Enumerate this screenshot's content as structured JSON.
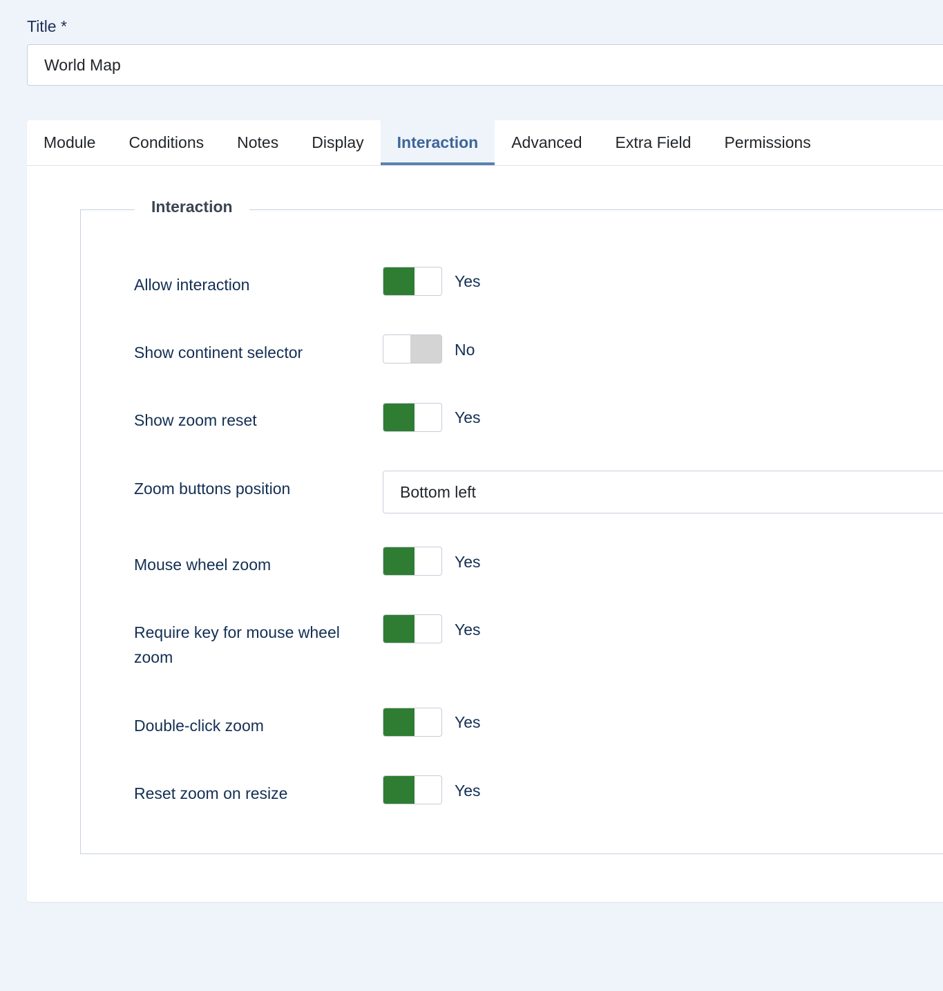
{
  "title_field": {
    "label": "Title *",
    "value": "World Map"
  },
  "tabs": [
    {
      "label": "Module"
    },
    {
      "label": "Conditions"
    },
    {
      "label": "Notes"
    },
    {
      "label": "Display"
    },
    {
      "label": "Interaction",
      "active": true
    },
    {
      "label": "Advanced"
    },
    {
      "label": "Extra Field"
    },
    {
      "label": "Permissions"
    }
  ],
  "fieldset": {
    "legend": "Interaction",
    "fields": {
      "allow_interaction": {
        "label": "Allow interaction",
        "value": "Yes",
        "on": true
      },
      "show_continent_selector": {
        "label": "Show continent selector",
        "value": "No",
        "on": false
      },
      "show_zoom_reset": {
        "label": "Show zoom reset",
        "value": "Yes",
        "on": true
      },
      "zoom_buttons_position": {
        "label": "Zoom buttons position",
        "value": "Bottom left"
      },
      "mouse_wheel_zoom": {
        "label": "Mouse wheel zoom",
        "value": "Yes",
        "on": true
      },
      "require_key": {
        "label": "Require key for mouse wheel zoom",
        "value": "Yes",
        "on": true
      },
      "double_click_zoom": {
        "label": "Double-click zoom",
        "value": "Yes",
        "on": true
      },
      "reset_zoom_on_resize": {
        "label": "Reset zoom on resize",
        "value": "Yes",
        "on": true
      }
    }
  },
  "colors": {
    "background": "#eff4fb",
    "switch_on": "#2e7d33",
    "switch_off": "#d4d4d4",
    "tab_active_text": "#3d6598",
    "tab_active_underline": "#5c80ad",
    "label_text": "#132f53"
  }
}
